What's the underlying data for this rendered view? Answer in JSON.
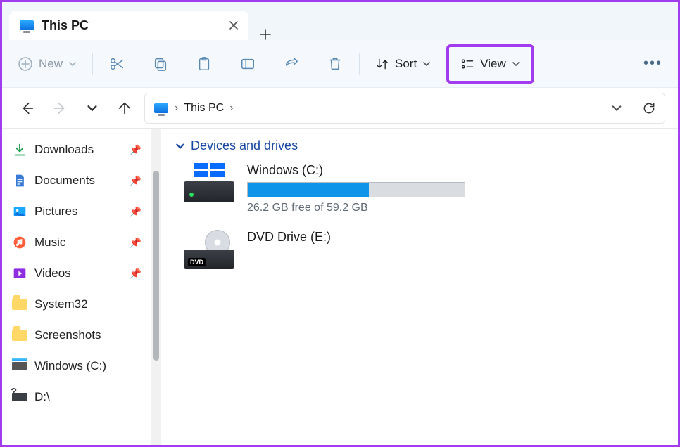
{
  "tab": {
    "title": "This PC"
  },
  "toolbar": {
    "new_label": "New",
    "sort_label": "Sort",
    "view_label": "View"
  },
  "breadcrumb": {
    "location": "This PC"
  },
  "sidebar": {
    "items": [
      {
        "label": "Downloads",
        "icon": "download",
        "pinned": true
      },
      {
        "label": "Documents",
        "icon": "doc",
        "pinned": true
      },
      {
        "label": "Pictures",
        "icon": "pic",
        "pinned": true
      },
      {
        "label": "Music",
        "icon": "music",
        "pinned": true
      },
      {
        "label": "Videos",
        "icon": "video",
        "pinned": true
      },
      {
        "label": "System32",
        "icon": "folder",
        "pinned": false
      },
      {
        "label": "Screenshots",
        "icon": "folder",
        "pinned": false
      },
      {
        "label": "Windows (C:)",
        "icon": "drive",
        "pinned": false
      },
      {
        "label": "D:\\",
        "icon": "usb",
        "pinned": false
      }
    ]
  },
  "main": {
    "section_header": "Devices and drives",
    "drives": [
      {
        "name": "Windows (C:)",
        "free_text": "26.2 GB free of 59.2 GB",
        "fill_pct": 55.7,
        "kind": "hdd"
      },
      {
        "name": "DVD Drive (E:)",
        "kind": "dvd",
        "badge": "DVD"
      }
    ]
  }
}
